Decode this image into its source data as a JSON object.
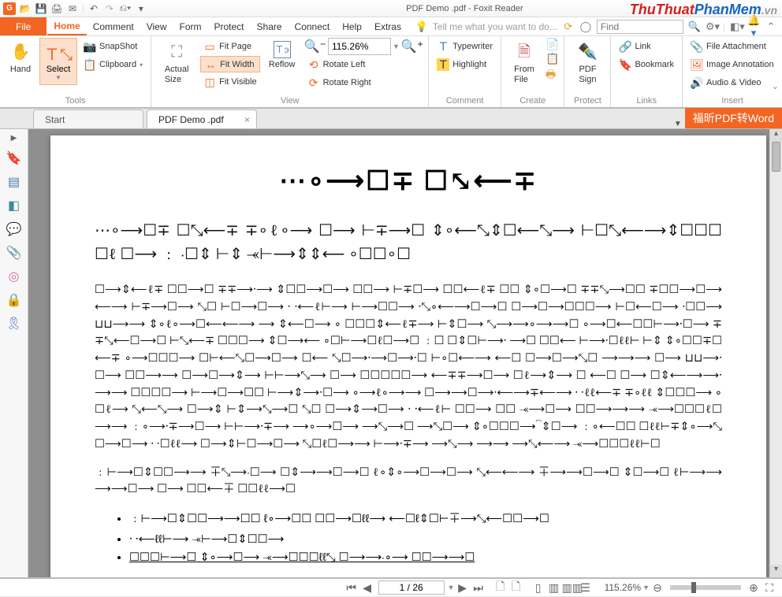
{
  "title": "PDF Demo .pdf - Foxit Reader",
  "watermark": {
    "p1": "ThuThuat",
    "p2": "PhanMem",
    "p3": ".vn"
  },
  "menuTabs": [
    "Home",
    "Comment",
    "View",
    "Form",
    "Protect",
    "Share",
    "Connect",
    "Help",
    "Extras"
  ],
  "fileLabel": "File",
  "tellMe": "Tell me what you want to do...",
  "findPlaceholder": "Find",
  "ribbon": {
    "hand": "Hand",
    "select": "Select",
    "snapshot": "SnapShot",
    "clipboard": "Clipboard",
    "toolsGroup": "Tools",
    "actualSize": "Actual\nSize",
    "fitPage": "Fit Page",
    "fitWidth": "Fit Width",
    "fitVisible": "Fit Visible",
    "reflow": "Reflow",
    "rotateLeft": "Rotate Left",
    "rotateRight": "Rotate Right",
    "zoomValue": "115.26%",
    "viewGroup": "View",
    "typewriter": "Typewriter",
    "highlight": "Highlight",
    "commentGroup": "Comment",
    "fromFile": "From\nFile",
    "createGroup": "Create",
    "pdfSign": "PDF\nSign",
    "protectGroup": "Protect",
    "link": "Link",
    "bookmark": "Bookmark",
    "linksGroup": "Links",
    "fileAtt": "File Attachment",
    "imageAnn": "Image Annotation",
    "audioVideo": "Audio & Video",
    "insertGroup": "Insert"
  },
  "docTabs": {
    "start": "Start",
    "active": "PDF Demo .pdf"
  },
  "convertLabel": "福昕PDF转Word",
  "navColors": {
    "bookmark": "#5a4aa8",
    "pages": "#4a77a8",
    "layers": "#3d8a9e",
    "comment": "#e3a13b",
    "attach": "#6f89a6",
    "portfolio": "#d06aa0",
    "lock": "#e6a23c",
    "sign": "#5a78c2"
  },
  "doc": {
    "heading": "⋯∘⟶☐∓ ☐⤡⟵∓",
    "lead": "⋯∘⟶☐∓ ☐⤡⟵∓ ∓∘ℓ∘⟶ ☐⟶ ⊢∓⟶☐ ⇕∘⟵⤡⇕☐⟵⤡⟶ ⊢☐⤡⟵⟶⇕☐☐☐ ☐ℓ ☐⟶ ﹕ ⸱☐⇕ ⊢⇕ ⤛⊢⟶⇕⇕⟵ ∘☐☐∘☐",
    "para": "☐⟶⇕⟵ℓ∓ ☐☐⟶☐ ∓∓⟶⸱⟶ ⇕☐☐⟶☐⟶ ☐☐⟶ ⊢∓☐⟶ ☐☐⟵ℓ∓ ☐☐ ⇕∘☐⟶☐ ∓∓⤡⟶☐☐ ∓☐☐⟶☐⟶ ⟵⟶ ⊢∓⟶☐⟶ ⤡☐ ⊢☐⟶☐⟶ ⸱ ⸱⟵ℓ⊢⟶ ⊢⟶☐☐⟶ ⸱⤡∘⟵⟶☐⟶☐ ☐⟶☐⟶☐☐☐⟶ ⊢☐⟵☐⟶ ⸱☐☐⟶ ⊔⊔⟶⟶ ⇕∘ℓ∘⟶☐⟵⟵⟶ ⟶ ⇕⟵☐⟶ ∘ ☐☐☐⇕⟵ℓ∓⟶ ⊢⇕☐⟶ ⤡⟶⟶∘⟶⟶☐ ∘⟶☐⟵☐☐⊢⟶⸱☐⟶ ∓∓⤡⟵☐⟶☐ ⊢⤡⟵∓ ☐☐☐⟶ ⇕☐⟶⟵ ∘☐⊢⟶☐ℓ☐⟶☐ ﹕☐ ☐⇕☐⊢⟶⸱ ⟶☐ ☐☐⟵ ⊢⟶⸱☐ℓℓ⊢ ⊢⇕ ⇕∘☐☐∓☐⟵∓ ∘⟶☐☐☐⟶ ☐⊢⟵⤡☐⟶☐⟶ ☐⟵ ⤡☐⟶⸱⟶☐⟶⸱☐ ⊢∘☐⟵⟶ ⟵☐ ☐⟶☐⟶⤡☐ ⟶⟶⟶ ☐⟶ ⊔⊔⟶⸱☐⟶ ☐☐⟶⟶ ☐⟶☐⟶⇕⟶ ⊢⊢⟶⤡⟶ ☐⟶ ☐☐☐☐☐⟶ ⟵∓∓⟶☐⟶ ☐ℓ⟶⇕⟶ ☐ ⟵☐ ☐⟶ ☐⇕⟵⟶⟶⸱⟶⟶ ☐☐☐☐⟶ ⊢⟶☐⟶☐☐ ⊢⟶⇕⟶⸱☐⟶ ∘⟶ℓ∘⟶⟶ ☐⟶⟶☐⟶⸱⟵⟶∓⟵⟶ ⸱ ⸱ℓℓ⟵∓ ∓∘ℓℓ ⇕☐☐☐⟶ ∘☐ℓ⟶ ⤡⟵⤡⟶ ☐⟶⇕ ⊢⇕⟶⤡⟶☐ ⤡☐ ☐⟶⇕⟶☐⟶ ⸱ ⸱⟵ℓ⊢ ☐☐⟶ ☐☐ ⤛⟶☐⟶ ☐☐⟶⟶⟶ ⤛⟶☐☐☐ℓ☐⟶⟶ ﹕∘⟶⸱∓⟶☐⟶ ⊢⊢⟶⸱∓⟶ ⟶∘⟶☐⟶ ⟶⤡⟶☐ ⟶⤡☐⟶ ⇕∘☐☐☐⟶⎴⇕☐⟶ ﹕∘⟵☐☐ ☐ℓℓ⊢∓⇕∘⟶⤡☐⟶☐⟶ ⸱ ⸱☐ℓℓ⟶ ☐⟶⇕⊢☐⟶☐⟶ ⤡☐ℓ☐⟶⟶ ⊢⟶⸱∓⟶ ⟶⤡⟶ ⟶⟶ ⟶⤡⟵⟶ ⤛⟶☐☐☐ℓℓ⊢☐",
    "shortPara": "﹕⊢⟶☐⇕☐☐⟶⟶ ∓⤡⟶⸱☐⟶ ☐⇕⟶⟶☐⟶☐ ℓ∘⇕∘⟶☐⟶☐⟶ ⤡⟵⟵⟶ ∓⟶⟶☐⟶☐ ⇕☐⟶☐ ℓ⊢⟶⟶⟶⟶☐⟶ ☐⟶ ☐☐⟵∓ ☐☐ℓℓ⟶☐",
    "bullet1": "﹕⊢⟶☐⇕☐☐⟶⟶☐☐ ℓ∘⟶☐☐ ☐☐⟶☐ℓℓ⟶ ⟵☐ℓ⇕☐⊢∓⟶⤡⟵☐☐⟶☐",
    "bullet2": "⸱ ⸱⟵ℓℓ⊢⟶ ⤛⊢⟶☐⇕☐☐⟶",
    "bullet3": "☐☐☐⊢⟶☐ ⇕∘⟶☐⟶ ⤛⟶☐☐☐ℓℓ⤡ ☐⟶⟶⸱∘⟶ ☐☐⟶⟶☐"
  },
  "status": {
    "page": "1 / 26",
    "zoom": "115.26%"
  }
}
